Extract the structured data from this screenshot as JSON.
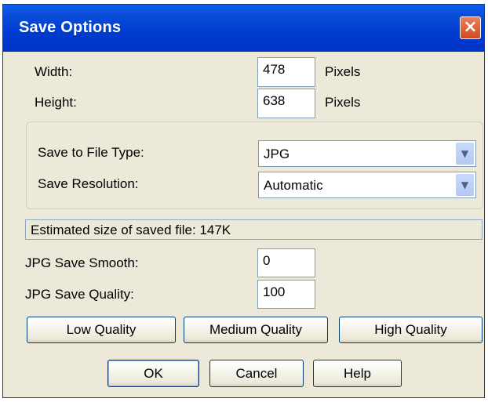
{
  "window": {
    "title": "Save Options",
    "close_icon": "×"
  },
  "dimensions": {
    "width_label": "Width:",
    "width_value": "478",
    "width_unit": "Pixels",
    "height_label": "Height:",
    "height_value": "638",
    "height_unit": "Pixels"
  },
  "save": {
    "file_type_label": "Save to File Type:",
    "file_type_value": "JPG",
    "resolution_label": "Save Resolution:",
    "resolution_value": "Automatic",
    "dropdown_arrow": "▼"
  },
  "status": {
    "estimated_size": "Estimated size of saved file: 147K"
  },
  "jpg": {
    "smooth_label": "JPG Save Smooth:",
    "smooth_value": "0",
    "quality_label": "JPG Save Quality:",
    "quality_value": "100"
  },
  "presets": {
    "low": "Low Quality",
    "medium": "Medium Quality",
    "high": "High Quality"
  },
  "actions": {
    "ok": "OK",
    "cancel": "Cancel",
    "help": "Help"
  },
  "colors": {
    "titlebar": "#0a4fd8",
    "dialog_bg": "#ece9d8",
    "close_button": "#d24a1f"
  }
}
